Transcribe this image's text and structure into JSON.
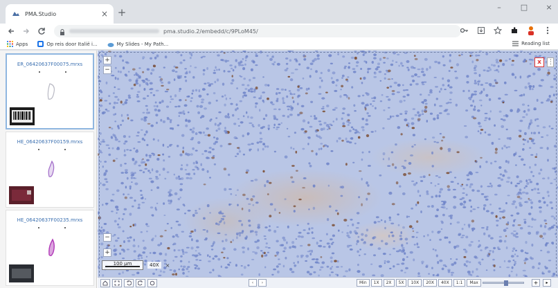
{
  "browser": {
    "tab_title": "PMA.Studio",
    "tab_close": "×",
    "new_tab": "+",
    "window_controls": [
      "–",
      "□",
      "×"
    ],
    "url_visible": "pma.studio.2/embedd/c/9PLoM45/",
    "bookmarks": [
      {
        "label": "Apps",
        "color": "#4285f4"
      },
      {
        "label": "Op reis door Italië i...",
        "color": "#1a73e8"
      },
      {
        "label": "My Slides - My Path...",
        "color": "#5b9bd5"
      }
    ],
    "reading_list": "Reading list"
  },
  "sidebar": {
    "slides": [
      {
        "name": "ER_06420637F00075.mrxs",
        "stain_color": "#b9b9c4",
        "selected": true,
        "thumb": "barcode"
      },
      {
        "name": "HE_06420637F00159.mrxs",
        "stain_color": "#a06ac8",
        "selected": false,
        "thumb": "maroon"
      },
      {
        "name": "HE_06420637F00235.mrxs",
        "stain_color": "#b13ab8",
        "selected": false,
        "thumb": "dark"
      }
    ]
  },
  "viewer": {
    "zoom_in": "+",
    "zoom_out": "−",
    "close": "x",
    "menu": "⋮",
    "scale_label": "100 µm",
    "magnification": "40X",
    "mag_close": "×",
    "pager": [
      "‹",
      "›"
    ],
    "zoom_levels": [
      "Min",
      "1X",
      "2X",
      "5X",
      "10X",
      "20X",
      "40X",
      "1:1",
      "Max"
    ],
    "zoom_level_fraction": 0.55,
    "zoom_plus": "+",
    "zoom_arrow": "▸"
  },
  "colors": {
    "nuclei_blue": "#6f84c8",
    "dab_brown": "#7a4a2e",
    "stroma": "#d9b896",
    "accent_red": "#d93025"
  }
}
